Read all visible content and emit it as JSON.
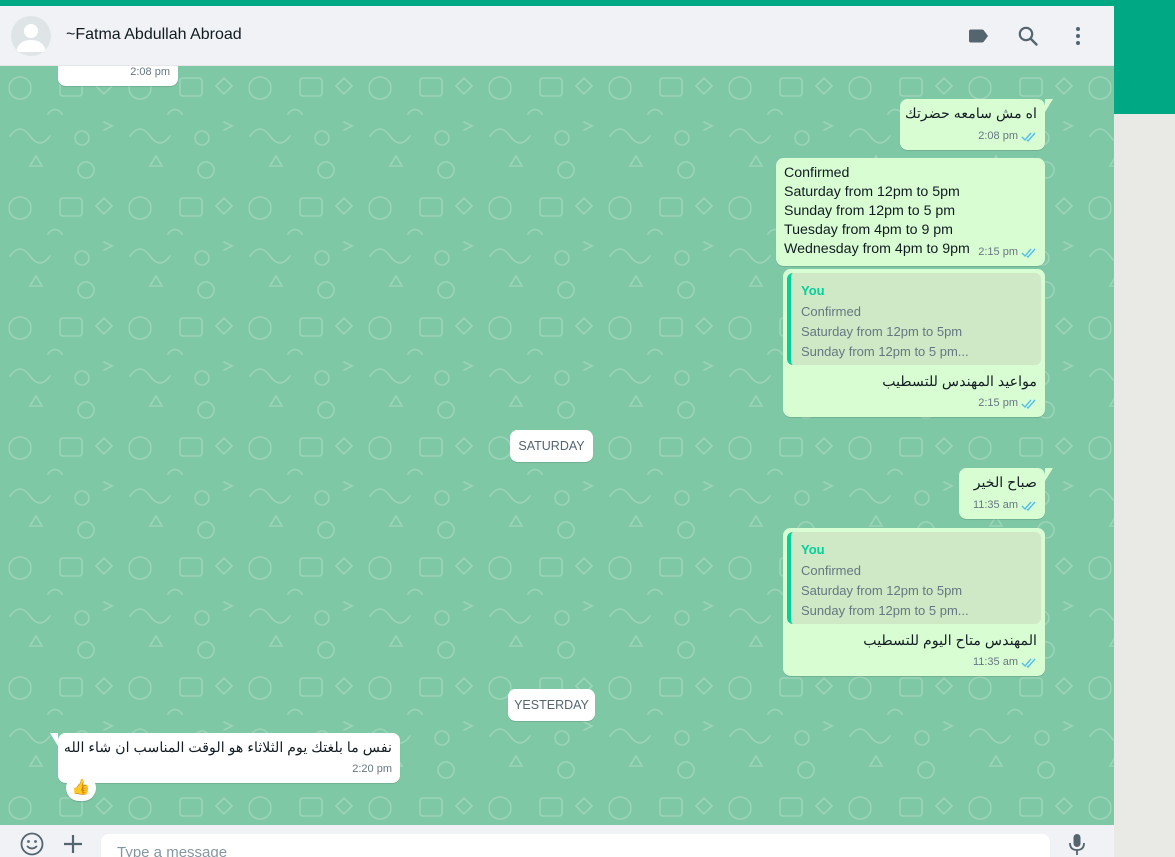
{
  "contact": {
    "name": "~Fatma Abdullah Abroad"
  },
  "header_icons": [
    "label-icon",
    "search-icon",
    "menu-icon"
  ],
  "messages": {
    "m0": {
      "time": "2:08 pm"
    },
    "m1": {
      "text": "اه مش سامعه حضرتك",
      "time": "2:08 pm"
    },
    "m2": {
      "lines": [
        "Confirmed",
        "Saturday from 12pm to 5pm",
        "Sunday from 12pm to 5 pm",
        "Tuesday from 4pm to 9 pm",
        "Wednesday from 4pm to 9pm"
      ],
      "time": "2:15 pm"
    },
    "m3": {
      "quote": {
        "author": "You",
        "lines": [
          "Confirmed",
          "Saturday from 12pm to 5pm",
          "Sunday from 12pm to 5 pm..."
        ]
      },
      "text": "مواعيد المهندس للتسطيب",
      "time": "2:15 pm"
    },
    "m4": {
      "text": "صباح الخير",
      "time": "11:35 am"
    },
    "m5": {
      "quote": {
        "author": "You",
        "lines": [
          "Confirmed",
          "Saturday from 12pm to 5pm",
          "Sunday from 12pm to 5 pm..."
        ]
      },
      "text": "المهندس  متاح اليوم للتسطيب",
      "time": "11:35 am"
    },
    "m6": {
      "text": "نفس ما بلغتك  يوم الثلاثاء هو الوقت المناسب ان شاء الله",
      "time": "2:20 pm",
      "reaction": "👍"
    }
  },
  "dividers": {
    "saturday": "SATURDAY",
    "yesterday": "YESTERDAY"
  },
  "footer": {
    "placeholder": "Type a message"
  },
  "colors": {
    "brand": "#00a884",
    "chat_bg": "#7fc8a5",
    "outgoing": "#d9fdd3",
    "incoming": "#ffffff",
    "read_ticks": "#53bdeb"
  }
}
